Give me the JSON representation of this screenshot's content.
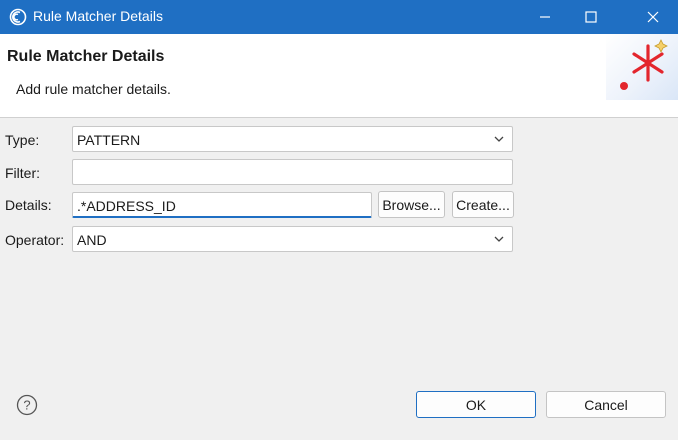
{
  "window": {
    "title": "Rule Matcher Details",
    "icon": "eclipse-app-icon",
    "controls": [
      "minimize-icon",
      "maximize-icon",
      "close-icon"
    ]
  },
  "header": {
    "title": "Rule Matcher Details",
    "description": "Add rule matcher details.",
    "graphic": "wizard-star-graphic"
  },
  "form": {
    "type": {
      "label": "Type:",
      "value": "PATTERN"
    },
    "filter": {
      "label": "Filter:",
      "value": ""
    },
    "details": {
      "label": "Details:",
      "value": ".*ADDRESS_ID",
      "browse_label": "Browse...",
      "create_label": "Create..."
    },
    "operator": {
      "label": "Operator:",
      "value": "AND"
    }
  },
  "footer": {
    "help_icon": "help-icon",
    "ok_label": "OK",
    "cancel_label": "Cancel"
  },
  "colors": {
    "titlebar": "#1f6fc3",
    "accent": "#1f6fc3",
    "graphic_star": "#e3262d"
  }
}
